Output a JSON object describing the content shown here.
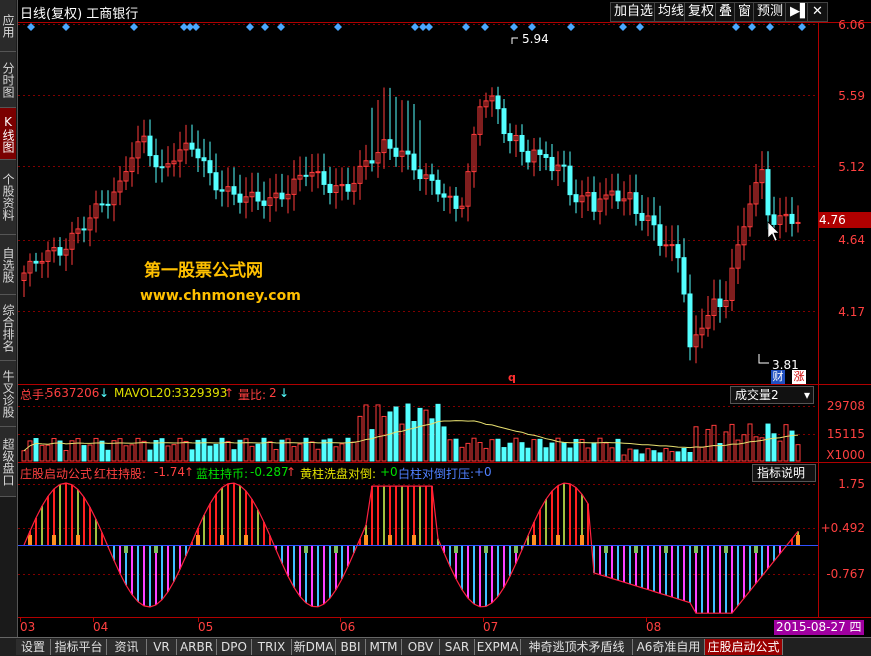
{
  "sidebar": {
    "tabs": [
      {
        "label": "应用",
        "active": false
      },
      {
        "label": "分时图",
        "active": false
      },
      {
        "label": "K线图",
        "active": true
      },
      {
        "label": "个股资料",
        "active": false
      },
      {
        "label": "自选股",
        "active": false
      },
      {
        "label": "综合排名",
        "active": false
      },
      {
        "label": "牛叉诊股",
        "active": false
      },
      {
        "label": "超级盘口",
        "active": false
      }
    ]
  },
  "header": {
    "title": "日线(复权) 工商银行",
    "buttons": [
      "加自选",
      "均线",
      "复权",
      "叠",
      "窗",
      "预测"
    ],
    "nav_icon": "play-bar-icon"
  },
  "price_axis": {
    "ticks": [
      "6.06",
      "5.59",
      "5.12",
      "4.64",
      "4.17"
    ],
    "current": "4.76",
    "high_label": "5.94",
    "low_label": "3.81"
  },
  "watermark": {
    "line1": "第一股票公式网",
    "line2": "www.chnmoney.com"
  },
  "badges": {
    "cai": "财",
    "zhang": "涨",
    "q_marker": "q"
  },
  "volume_panel": {
    "total_label": "总手:",
    "total_value": "5637206",
    "mavol_label": "MAVOL20:",
    "mavol_value": "3329393",
    "ratio_label": "量比:",
    "ratio_value": "2",
    "selector": "成交量2",
    "ticks": [
      "29708",
      "15115"
    ],
    "unit": "X1000"
  },
  "indicator_panel": {
    "name": "庄股启动公式",
    "red_label": "红柱持股:",
    "red_value": "-1.74",
    "blue_label": "蓝柱持币:",
    "blue_value": "-0.287",
    "yellow_label": "黄柱洗盘对倒:",
    "yellow_value": "+0",
    "white_label": "白柱对倒打压:",
    "white_value": "+0",
    "help_button": "指标说明",
    "ticks": [
      "1.75",
      "+0.492",
      "-0.767"
    ]
  },
  "time_axis": {
    "months": [
      "03",
      "04",
      "05",
      "06",
      "07",
      "08"
    ],
    "cursor_date": "2015-08-27 四"
  },
  "bottom_tabs": [
    {
      "label": "设置",
      "active": false
    },
    {
      "label": "指标平台",
      "active": false
    },
    {
      "label": "资讯",
      "active": false
    },
    {
      "label": "VR",
      "active": false
    },
    {
      "label": "ARBR",
      "active": false
    },
    {
      "label": "DPO",
      "active": false
    },
    {
      "label": "TRIX",
      "active": false
    },
    {
      "label": "新DMA",
      "active": false
    },
    {
      "label": "BBI",
      "active": false
    },
    {
      "label": "MTM",
      "active": false
    },
    {
      "label": "OBV",
      "active": false
    },
    {
      "label": "SAR",
      "active": false
    },
    {
      "label": "EXPMA",
      "active": false
    },
    {
      "label": "神奇逃顶术矛盾线",
      "active": false
    },
    {
      "label": "A6奇准自用",
      "active": false
    },
    {
      "label": "庄股启动公式",
      "active": true
    }
  ],
  "colors": {
    "up": "#ff3b3b",
    "down": "#54ffff",
    "axis": "#b00000",
    "label_red": "#ff4040",
    "label_green": "#00e000",
    "label_yellow": "#e0e000",
    "label_blue": "#5080ff",
    "watermark": "#ffc000"
  }
}
